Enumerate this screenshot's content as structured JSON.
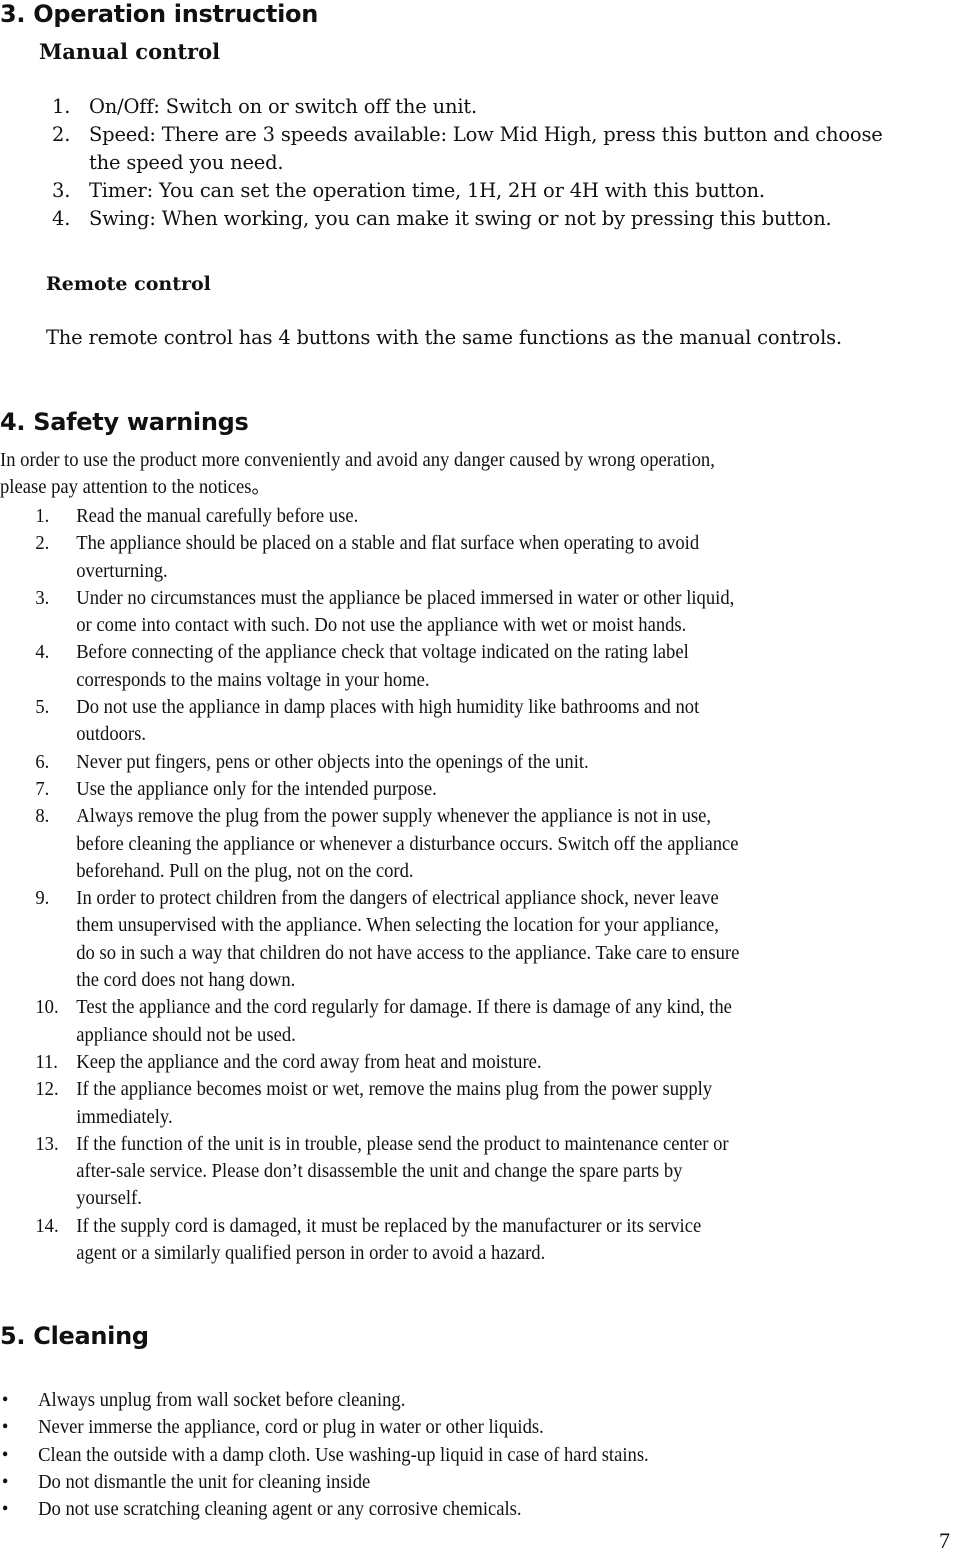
{
  "section3": {
    "heading": "3. Operation instruction",
    "manual_control": {
      "heading": "Manual control",
      "items": [
        {
          "num": "1.",
          "lines": [
            "On/Off: Switch on or switch off the unit."
          ]
        },
        {
          "num": "2.",
          "lines": [
            "Speed: There are 3 speeds available: Low Mid High, press this button and choose",
            "the speed you need."
          ]
        },
        {
          "num": "3.",
          "lines": [
            "Timer: You can set the operation time, 1H, 2H or 4H with this button."
          ]
        },
        {
          "num": "4.",
          "lines": [
            "Swing: When working, you can make it swing or not by pressing this button."
          ]
        }
      ]
    },
    "remote_control": {
      "heading": "Remote control",
      "text": "The remote control has 4 buttons with the same functions as the manual controls."
    }
  },
  "section4": {
    "heading": "4. Safety warnings",
    "intro_lines": [
      "In order to use the product more conveniently and avoid any danger caused by wrong operation,",
      "please pay attention to the notices。"
    ],
    "items": [
      {
        "num": "1.",
        "lines": [
          "Read the manual carefully before use."
        ]
      },
      {
        "num": "2.",
        "lines": [
          "The appliance should be placed on a stable and flat surface when operating to avoid",
          "overturning."
        ]
      },
      {
        "num": "3.",
        "lines": [
          "Under no circumstances must the appliance be placed immersed in water or other liquid,",
          "or come into contact with such. Do not use the appliance with wet or moist hands."
        ]
      },
      {
        "num": "4.",
        "lines": [
          "Before connecting of the appliance check that voltage indicated on the rating label",
          "corresponds to the mains voltage in your home."
        ]
      },
      {
        "num": "5.",
        "lines": [
          "Do not use the appliance in damp places with high humidity like bathrooms and not",
          "outdoors."
        ]
      },
      {
        "num": "6.",
        "lines": [
          "Never put fingers, pens or other objects into the openings of the unit."
        ]
      },
      {
        "num": "7.",
        "lines": [
          "Use the appliance only for the intended purpose."
        ]
      },
      {
        "num": "8.",
        "lines": [
          "Always remove the plug from the power supply whenever the appliance is not in use,",
          "before cleaning the appliance or whenever a disturbance occurs. Switch off the appliance",
          "beforehand. Pull on the plug, not on the cord."
        ]
      },
      {
        "num": "9.",
        "lines": [
          "In order to protect children from the dangers of electrical appliance shock, never leave",
          "them unsupervised with the appliance. When selecting the location for your appliance,",
          "do so in such a way that children do not have access to the appliance. Take care to ensure",
          "the cord does not hang down."
        ]
      },
      {
        "num": "10.",
        "lines": [
          "Test the appliance and the cord regularly for damage. If there is damage of any kind, the",
          "appliance should not be used."
        ]
      },
      {
        "num": "11.",
        "lines": [
          "Keep the appliance and the cord away from heat and moisture."
        ]
      },
      {
        "num": "12.",
        "lines": [
          "If the appliance becomes moist or wet, remove the mains plug from the power supply",
          "immediately."
        ]
      },
      {
        "num": "13.",
        "lines": [
          "If the function of the unit is in trouble, please send the product to maintenance center or",
          "after-sale service. Please don’t disassemble the unit and change the spare parts by",
          "yourself."
        ]
      },
      {
        "num": "14.",
        "lines": [
          "If the supply cord is damaged, it must be replaced by the manufacturer or its service",
          "agent or a similarly qualified person in order to avoid a hazard."
        ]
      }
    ]
  },
  "section5": {
    "heading": "5. Cleaning",
    "bullet_icon": "•",
    "items": [
      "Always unplug from wall socket before cleaning.",
      "Never immerse the appliance, cord or plug in water or other liquids.",
      "Clean the outside with a damp cloth. Use washing-up liquid in case of hard stains.",
      "Do not dismantle the unit for cleaning inside",
      "Do not use scratching cleaning agent or any corrosive chemicals."
    ]
  },
  "page_number": "7"
}
